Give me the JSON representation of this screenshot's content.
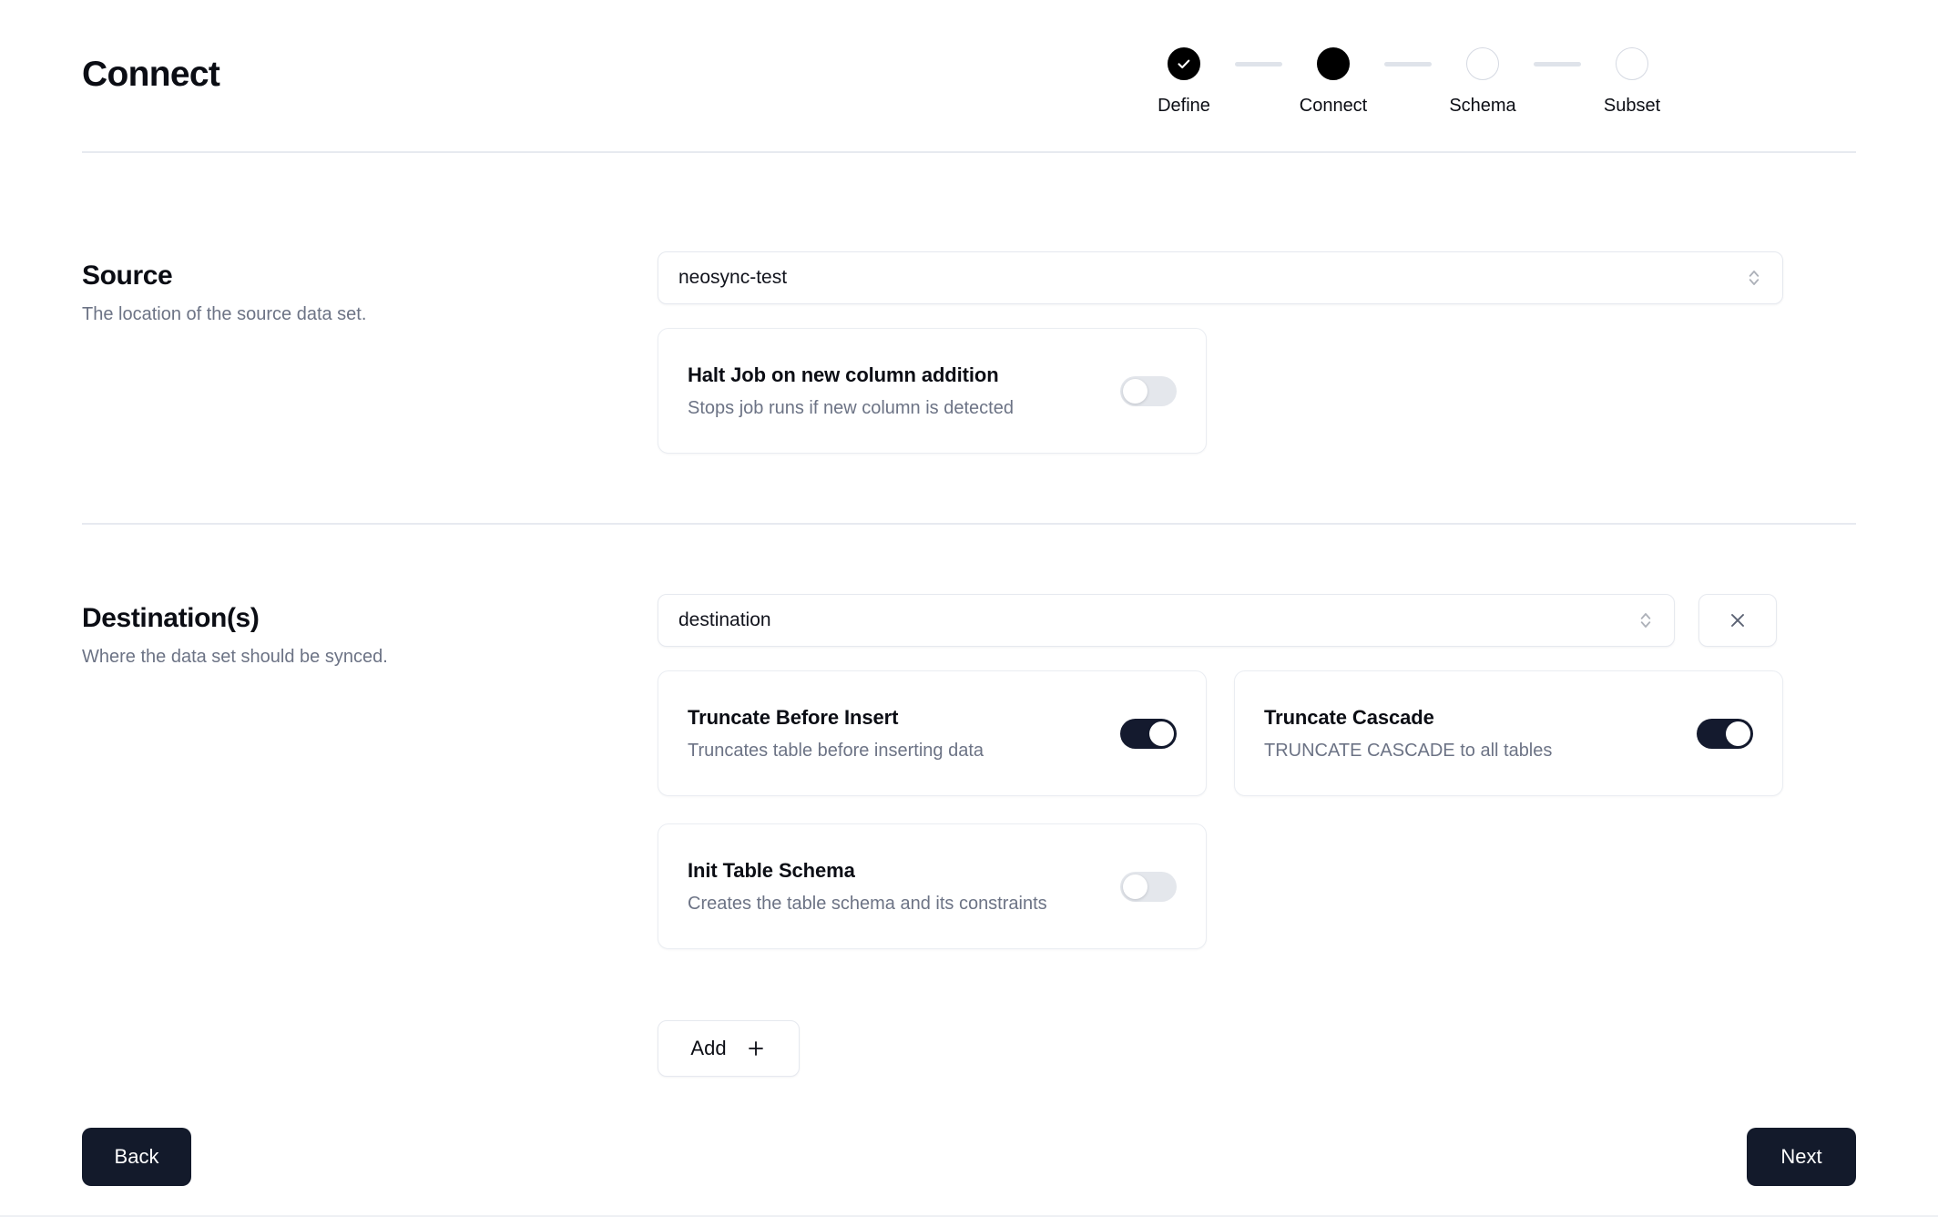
{
  "header": {
    "title": "Connect",
    "steps": [
      {
        "label": "Define",
        "state": "done"
      },
      {
        "label": "Connect",
        "state": "active"
      },
      {
        "label": "Schema",
        "state": "todo"
      },
      {
        "label": "Subset",
        "state": "todo"
      }
    ]
  },
  "source": {
    "title": "Source",
    "description": "The location of the source data set.",
    "select": {
      "value": "neosync-test",
      "placeholder": "Select a source"
    },
    "options": [
      {
        "title": "Halt Job on new column addition",
        "description": "Stops job runs if new column is detected",
        "enabled": "off"
      }
    ]
  },
  "destination": {
    "title": "Destination(s)",
    "description": "Where the data set should be synced.",
    "select": {
      "value": "destination",
      "placeholder": "Select a destination"
    },
    "remove_label": "Remove destination",
    "options": [
      {
        "title": "Truncate Before Insert",
        "description": "Truncates table before inserting data",
        "enabled": "on"
      },
      {
        "title": "Truncate Cascade",
        "description": "TRUNCATE CASCADE to all tables",
        "enabled": "on"
      },
      {
        "title": "Init Table Schema",
        "description": "Creates the table schema and its constraints",
        "enabled": "off"
      }
    ],
    "add_label": "Add"
  },
  "footer": {
    "back_label": "Back",
    "next_label": "Next"
  },
  "colors": {
    "accent_dark": "#131a2b",
    "toggle_on": "#141a2e",
    "toggle_off": "#e4e7ec",
    "border": "#e6e9ef",
    "muted_text": "#6c7385"
  }
}
